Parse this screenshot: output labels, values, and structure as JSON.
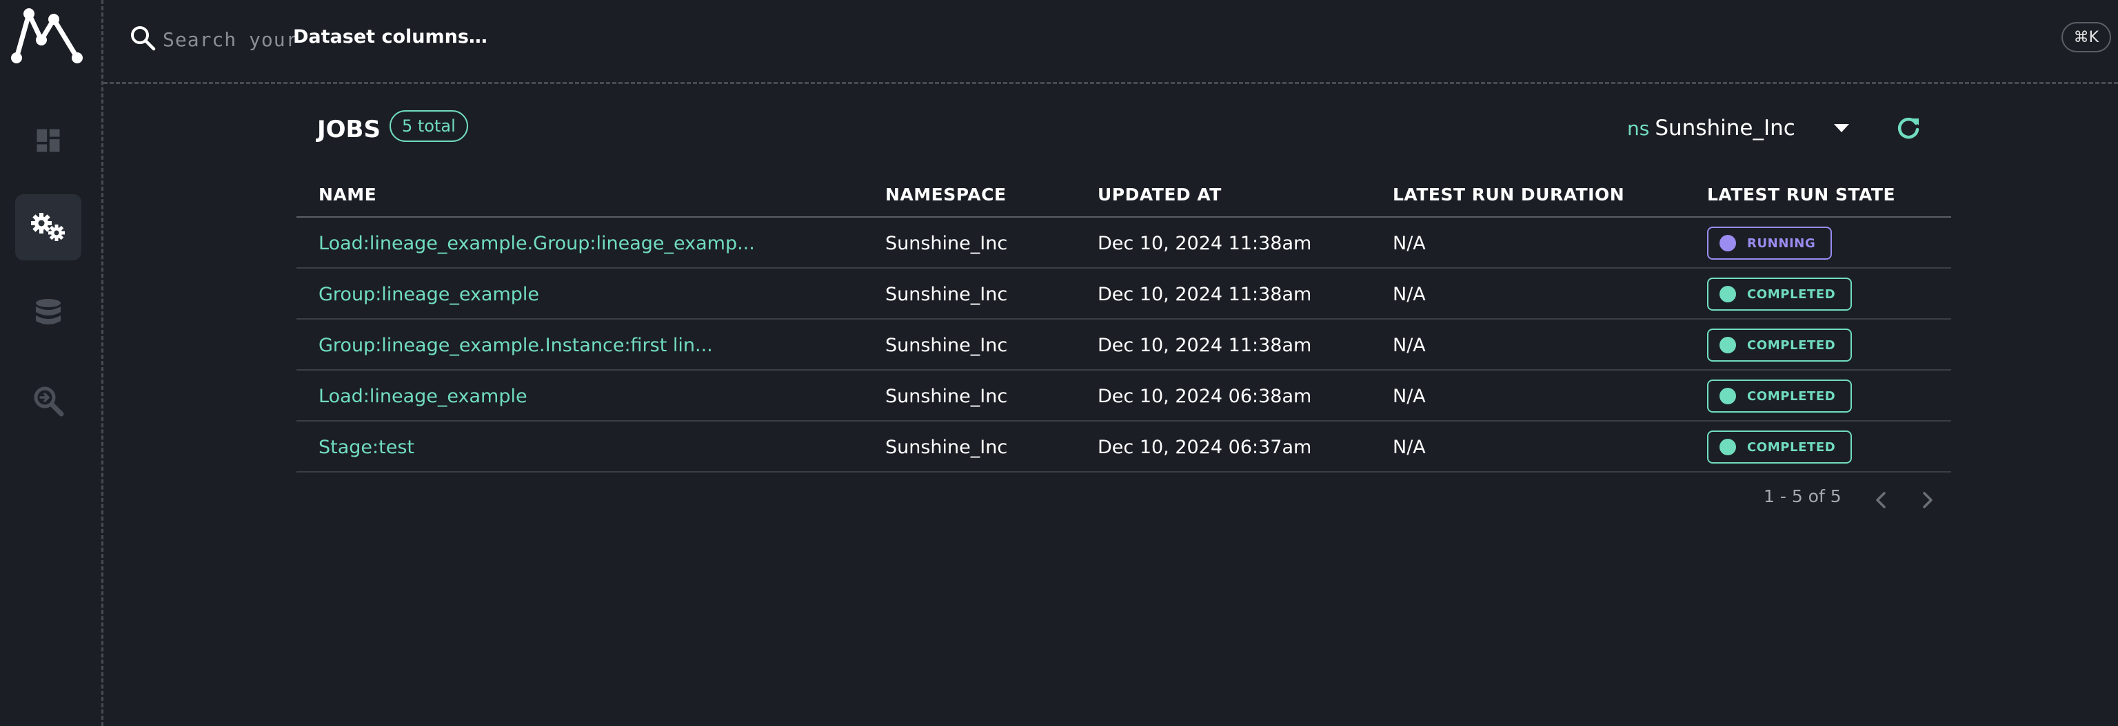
{
  "search": {
    "placeholder": "Search your",
    "emphasis": "Dataset columns…"
  },
  "shortcut": "⌘K",
  "sidebar": {
    "items": [
      {
        "name": "dashboard",
        "icon": "dashboard-icon",
        "active": false
      },
      {
        "name": "jobs",
        "icon": "gears-icon",
        "active": true
      },
      {
        "name": "datasets",
        "icon": "database-icon",
        "active": false
      },
      {
        "name": "events",
        "icon": "search-zoom-icon",
        "active": false
      }
    ]
  },
  "page": {
    "title": "JOBS",
    "total_badge": "5 total"
  },
  "namespace": {
    "prefix": "ns",
    "value": "Sunshine_Inc"
  },
  "table": {
    "headers": [
      "NAME",
      "NAMESPACE",
      "UPDATED AT",
      "LATEST RUN DURATION",
      "LATEST RUN STATE"
    ],
    "rows": [
      {
        "name": "Load:lineage_example.Group:lineage_examp...",
        "namespace": "Sunshine_Inc",
        "updated": "Dec 10, 2024 11:38am",
        "duration": "N/A",
        "state": "RUNNING"
      },
      {
        "name": "Group:lineage_example",
        "namespace": "Sunshine_Inc",
        "updated": "Dec 10, 2024 11:38am",
        "duration": "N/A",
        "state": "COMPLETED"
      },
      {
        "name": "Group:lineage_example.Instance:first lin...",
        "namespace": "Sunshine_Inc",
        "updated": "Dec 10, 2024 11:38am",
        "duration": "N/A",
        "state": "COMPLETED"
      },
      {
        "name": "Load:lineage_example",
        "namespace": "Sunshine_Inc",
        "updated": "Dec 10, 2024 06:38am",
        "duration": "N/A",
        "state": "COMPLETED"
      },
      {
        "name": "Stage:test",
        "namespace": "Sunshine_Inc",
        "updated": "Dec 10, 2024 06:37am",
        "duration": "N/A",
        "state": "COMPLETED"
      }
    ]
  },
  "pagination": {
    "text": "1 - 5 of 5"
  },
  "colors": {
    "background": "#1b1f25",
    "accent": "#71ddbf",
    "running": "#9a8cf0",
    "muted": "#a5aab0"
  }
}
